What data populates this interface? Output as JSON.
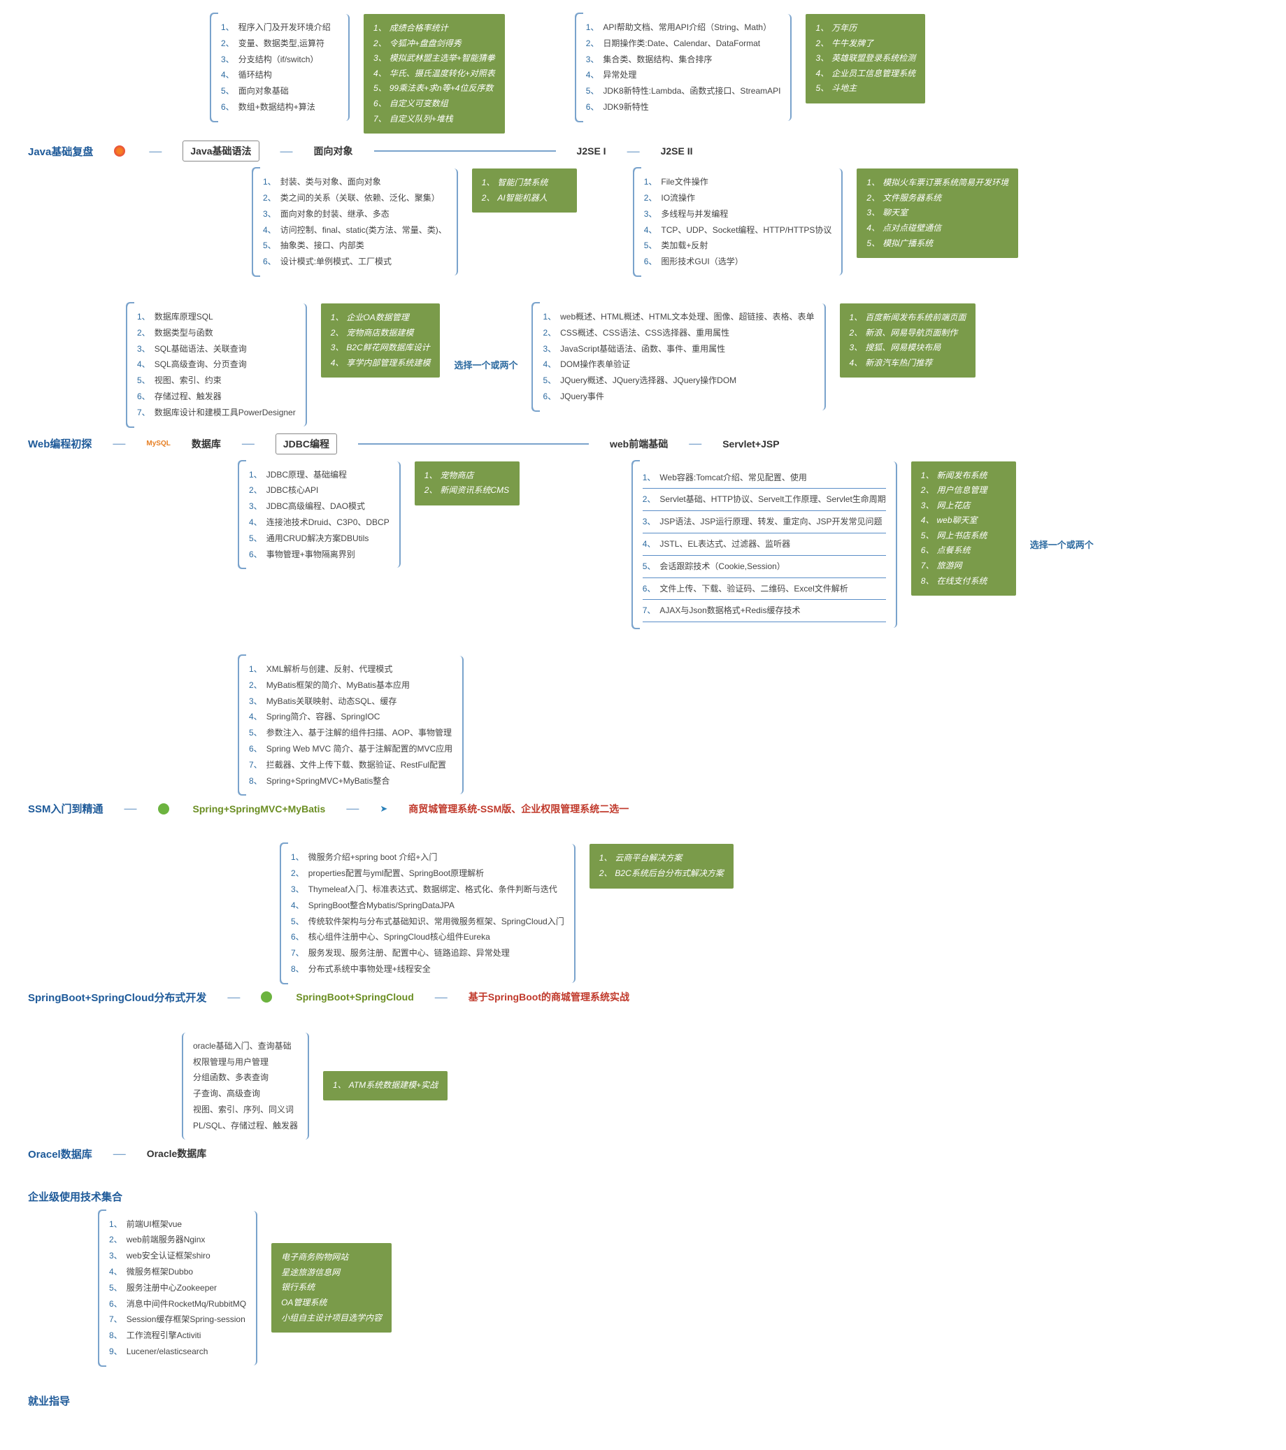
{
  "sections": {
    "javaReview": {
      "title": "Java基础复盘",
      "node1": "Java基础语法",
      "node2": "面向对象",
      "node3": "J2SE I",
      "node4": "J2SE II",
      "list_basic": [
        "程序入门及开发环境介绍",
        "变量、数据类型,运算符",
        "分支结构（if/switch）",
        "循环结构",
        "面向对象基础",
        "数组+数据结构+算法"
      ],
      "green_basic": [
        "成绩合格率统计",
        "令狐冲+盘盘剑得秀",
        "模拟武林盟主选举+智能猜拳",
        "华氏、摄氏温度转化+对照表",
        "99乘法表+求n等+4位反序数",
        "自定义可变数组",
        "自定义队列+堆栈"
      ],
      "list_j2se1": [
        "API帮助文档、常用API介绍（String、Math）",
        "日期操作类:Date、Calendar、DataFormat",
        "集合类、数据结构、集合排序",
        "异常处理",
        "JDK8新特性:Lambda、函数式接口、StreamAPI",
        "JDK9新特性"
      ],
      "green_j2se1": [
        "万年历",
        "牛牛发牌了",
        "英雄联盟登录系统检测",
        "企业员工信息管理系统",
        "斗地主"
      ],
      "list_oop": [
        "封装、类与对象、面向对象",
        "类之间的关系（关联、依赖、泛化、聚集）",
        "面向对象的封装、继承、多态",
        "访问控制、final、static(类方法、常量、类)、",
        "抽象类、接口、内部类",
        "设计模式:单例模式、工厂模式"
      ],
      "green_oop": [
        "智能门禁系统",
        "AI智能机器人"
      ],
      "list_j2se2": [
        "File文件操作",
        "IO流操作",
        "多线程与并发编程",
        "TCP、UDP、Socket编程、HTTP/HTTPS协议",
        "类加载+反射",
        "图形技术GUI（选学）"
      ],
      "green_j2se2": [
        "模拟火车票订票系统简易开发环境",
        "文件服务器系统",
        "聊天室",
        "点对点碰壁通信",
        "模拟广播系统"
      ]
    },
    "webIntro": {
      "title": "Web编程初探",
      "node_mysql": "MySQL",
      "node_db": "数据库",
      "node_jdbc": "JDBC编程",
      "node_webfront": "web前端基础",
      "node_servlet": "Servlet+JSP",
      "note_choose": "选择一个或两个",
      "note_choose2": "选择一个或两个",
      "list_db": [
        "数据库原理SQL",
        "数据类型与函数",
        "SQL基础语法、关联查询",
        "SQL高级查询、分页查询",
        "视图、索引、约束",
        "存储过程、触发器",
        "数据库设计和建模工具PowerDesigner"
      ],
      "green_db": [
        "企业OA数据管理",
        "宠物商店数据建模",
        "B2C鲜花网数据库设计",
        "享学内部管理系统建模"
      ],
      "list_jdbc": [
        "JDBC原理、基础编程",
        "JDBC核心API",
        "JDBC高级编程、DAO模式",
        "连接池技术Druid、C3P0、DBCP",
        "通用CRUD解决方案DBUtils",
        "事物管理+事物隔离界别"
      ],
      "green_jdbc": [
        "宠物商店",
        "新闻资讯系统CMS"
      ],
      "list_webfront": [
        "web概述、HTML概述、HTML文本处理、图像、超链接、表格、表单",
        "CSS概述、CSS语法、CSS选择器、重用属性",
        "JavaScript基础语法、函数、事件、重用属性",
        "DOM操作表单验证",
        "JQuery概述、JQuery选择器、JQuery操作DOM",
        "JQuery事件"
      ],
      "green_webfront": [
        "百度新闻发布系统前端页面",
        "新浪、网易导航页面制作",
        "搜狐、网易模块布局",
        "新浪汽车热门推荐"
      ],
      "list_servlet": [
        "Web容器:Tomcat介绍、常见配置、使用",
        "Servlet基础、HTTP协议、Servelt工作原理、Servlet生命周期",
        "JSP语法、JSP运行原理、转发、重定向、JSP开发常见问题",
        "JSTL、EL表达式、过滤器、监听器",
        "会话跟踪技术（Cookie,Session）",
        "文件上传、下载、验证码、二维码、Excel文件解析",
        "AJAX与Json数据格式+Redis缓存技术"
      ],
      "green_servlet": [
        "新闻发布系统",
        "用户信息管理",
        "网上花店",
        "web聊天室",
        "网上书店系统",
        "点餐系统",
        "旅游网",
        "在线支付系统"
      ]
    },
    "ssm": {
      "title": "SSM入门到精通",
      "node_spring": "Spring+SpringMVC+MyBatis",
      "red_note": "商贸城管理系统-SSM版、企业权限管理系统二选一",
      "list_ssm": [
        "XML解析与创建、反射、代理模式",
        "MyBatis框架的简介、MyBatis基本应用",
        "MyBatis关联映射、动态SQL、缓存",
        "Spring简介、容器、SpringIOC",
        "参数注入、基于注解的组件扫描、AOP、事物管理",
        "Spring Web MVC 简介、基于注解配置的MVC应用",
        "拦截器、文件上传下载、数据验证、RestFul配置",
        "Spring+SpringMVC+MyBatis整合"
      ]
    },
    "springboot": {
      "title": "SpringBoot+SpringCloud分布式开发",
      "node_sb": "SpringBoot+SpringCloud",
      "red_note": "基于SpringBoot的商城管理系统实战",
      "list_sb": [
        "微服务介绍+spring boot 介绍+入门",
        "properties配置与yml配置、SpringBoot原理解析",
        "Thymeleaf入门、标准表达式、数据绑定、格式化、条件判断与迭代",
        "SpringBoot整合Mybatis/SpringDataJPA",
        "传统软件架构与分布式基础知识、常用微服务框架、SpringCloud入门",
        "核心组件注册中心、SpringCloud核心组件Eureka",
        "服务发现、服务注册、配置中心、链路追踪、异常处理",
        "分布式系统中事物处理+线程安全"
      ],
      "green_sb": [
        "云商平台解决方案",
        "B2C系统后台分布式解决方案"
      ]
    },
    "oracle": {
      "title": "Oracel数据库",
      "node_oracle": "Oracle数据库",
      "list_oracle": [
        "oracle基础入门、查询基础",
        "权限管理与用户管理",
        "分组函数、多表查询",
        "子查询、高级查询",
        "视图、索引、序列、同义词",
        "PL/SQL、存储过程、触发器"
      ],
      "green_oracle": [
        "ATM系统数据建模+实战"
      ]
    },
    "enterprise": {
      "title": "企业级使用技术集合",
      "list_ent": [
        "前端UI框架vue",
        "web前端服务器Nginx",
        "web安全认证框架shiro",
        "微服务框架Dubbo",
        "服务注册中心Zookeeper",
        "消息中间件RocketMq/RubbitMQ",
        "Session缓存框架Spring-session",
        "工作流程引擎Activiti",
        "Lucener/elasticsearch"
      ],
      "green_ent": [
        "电子商务购物网站",
        "星途旅游信息网",
        "银行系统",
        "OA管理系统",
        "小组自主设计项目选学内容"
      ]
    },
    "career": {
      "title": "就业指导"
    }
  }
}
